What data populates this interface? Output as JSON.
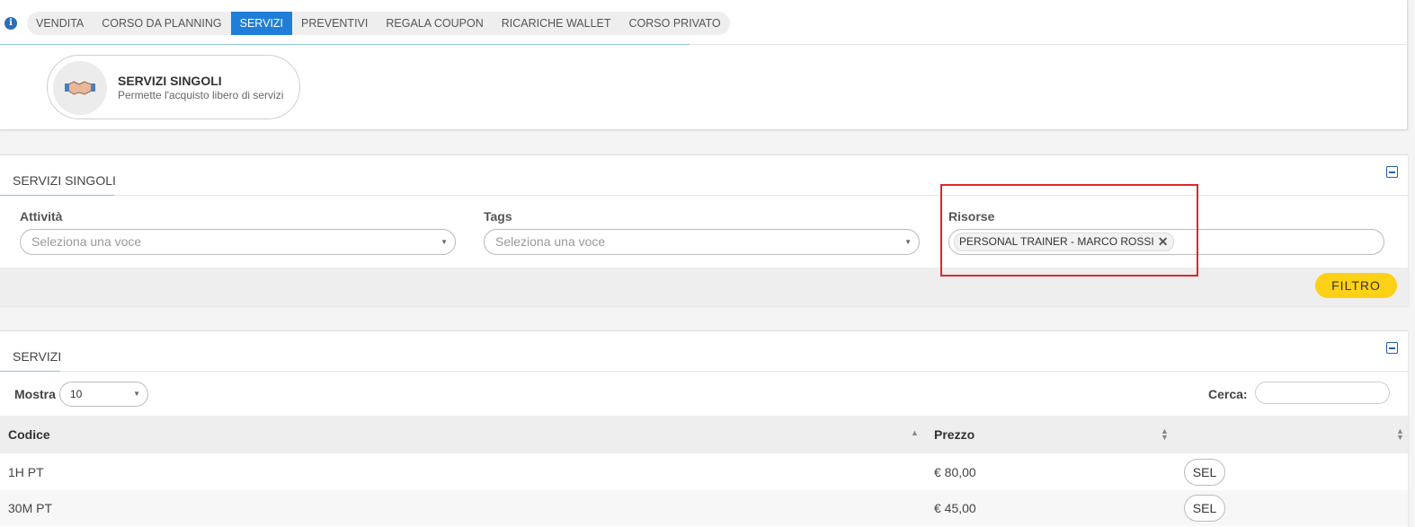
{
  "tabs": [
    {
      "label": "VENDITA",
      "active": false
    },
    {
      "label": "CORSO DA PLANNING",
      "active": false
    },
    {
      "label": "SERVIZI",
      "active": true
    },
    {
      "label": "PREVENTIVI",
      "active": false
    },
    {
      "label": "REGALA COUPON",
      "active": false
    },
    {
      "label": "RICARICHE WALLET",
      "active": false
    },
    {
      "label": "CORSO PRIVATO",
      "active": false
    }
  ],
  "info_icon": "info-icon",
  "service_card": {
    "icon": "handshake-icon",
    "title": "SERVIZI SINGOLI",
    "subtitle": "Permette l'acquisto libero di servizi"
  },
  "filter_panel": {
    "title": "SERVIZI SINGOLI",
    "attivita": {
      "label": "Attività",
      "placeholder": "Seleziona una voce"
    },
    "tags": {
      "label": "Tags",
      "placeholder": "Seleziona una voce"
    },
    "risorse": {
      "label": "Risorse",
      "selected": "PERSONAL TRAINER - MARCO ROSSI"
    },
    "filter_button": "FILTRO"
  },
  "services_panel": {
    "title": "SERVIZI",
    "show_label": "Mostra",
    "show_value": "10",
    "search_label": "Cerca:",
    "search_value": "",
    "columns": [
      "Codice",
      "Prezzo"
    ],
    "rows": [
      {
        "codice": "1H PT",
        "prezzo": "€ 80,00",
        "action": "SEL"
      },
      {
        "codice": "30M PT",
        "prezzo": "€ 45,00",
        "action": "SEL"
      }
    ]
  },
  "colors": {
    "active_tab": "#1f7fd8",
    "filter_button": "#fcd116",
    "highlight": "#e0262b"
  }
}
